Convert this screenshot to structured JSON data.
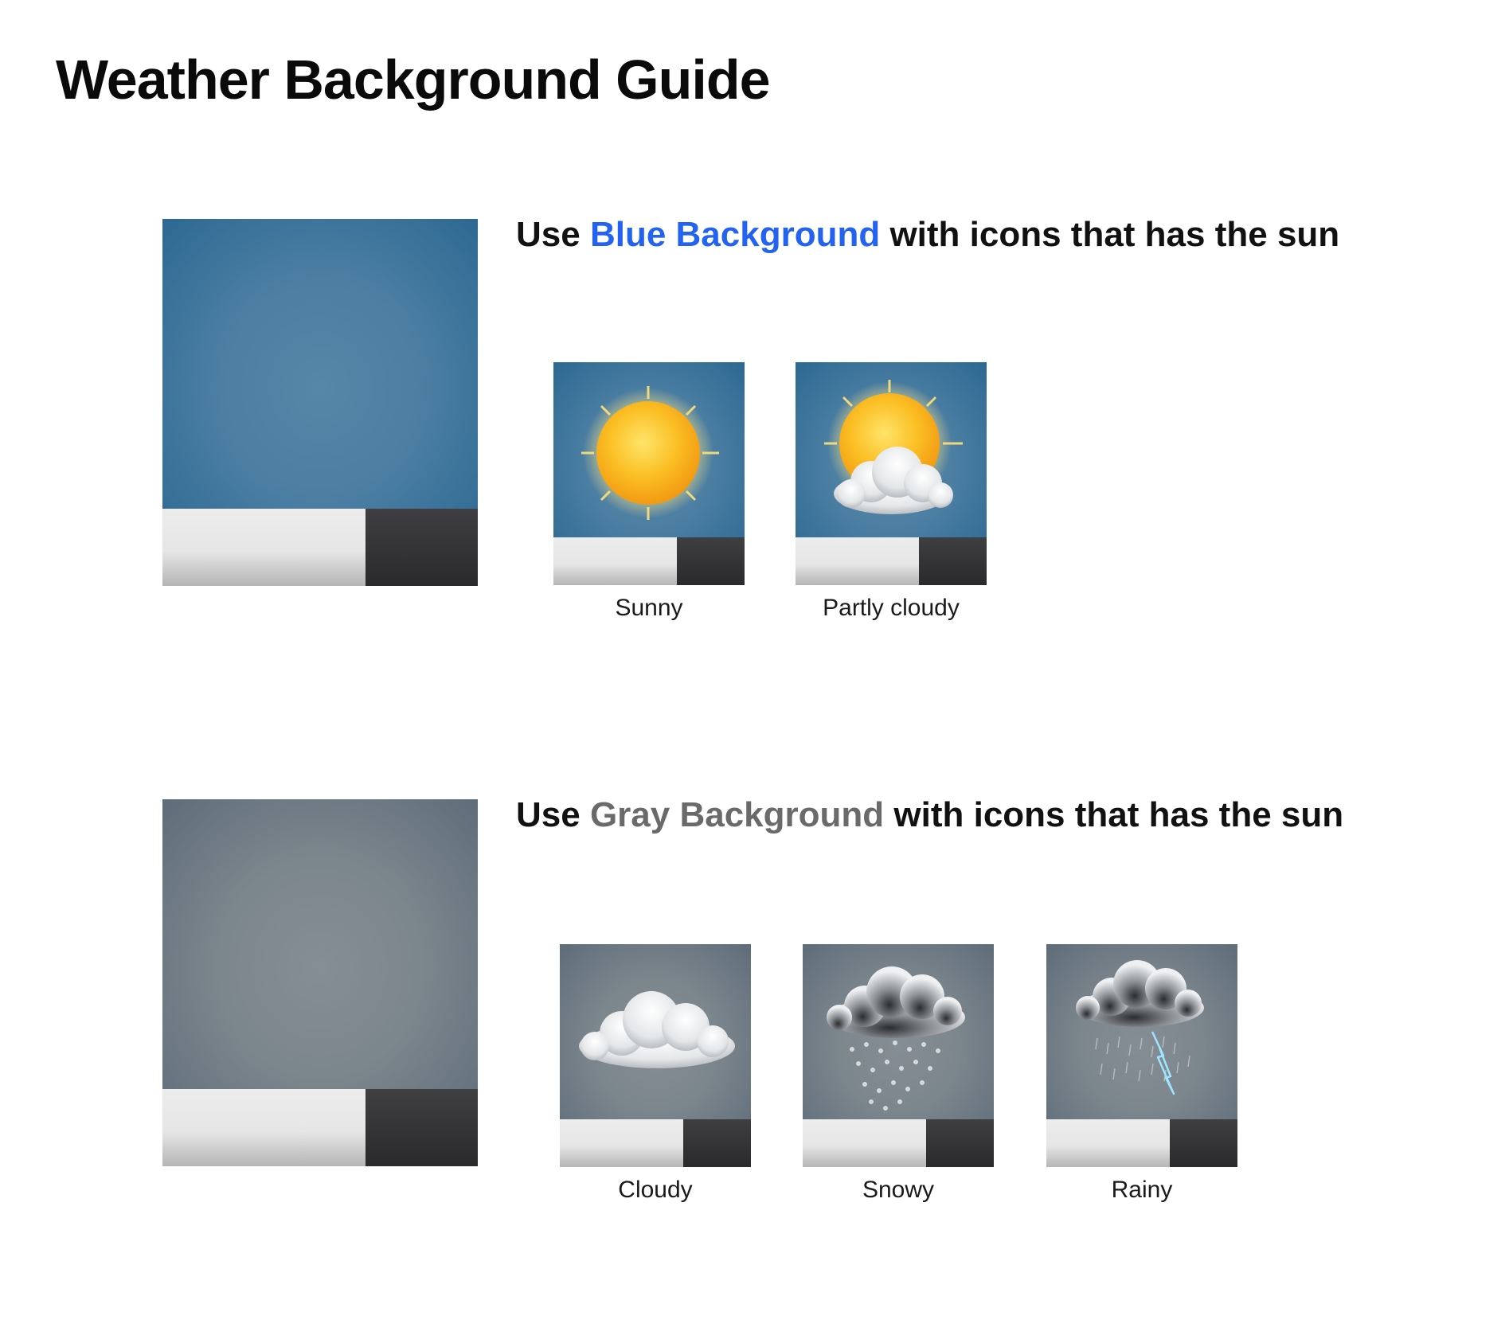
{
  "page": {
    "title": "Weather Background Guide"
  },
  "sections": [
    {
      "heading_prefix": "Use ",
      "heading_highlight": "Blue Background",
      "heading_suffix": " with icons that has the sun",
      "highlight_color": "#2363f0",
      "background_color": "#4d7fa3",
      "tiles": [
        {
          "label": "Sunny",
          "icon": "sun-icon"
        },
        {
          "label": "Partly cloudy",
          "icon": "partly-cloudy-icon"
        }
      ]
    },
    {
      "heading_prefix": "Use ",
      "heading_highlight": "Gray Background",
      "heading_suffix": " with icons that has the sun",
      "highlight_color": "#6a6a6a",
      "background_color": "#7c868d",
      "tiles": [
        {
          "label": "Cloudy",
          "icon": "cloud-icon"
        },
        {
          "label": "Snowy",
          "icon": "snow-cloud-icon"
        },
        {
          "label": "Rainy",
          "icon": "storm-cloud-icon"
        }
      ]
    }
  ]
}
